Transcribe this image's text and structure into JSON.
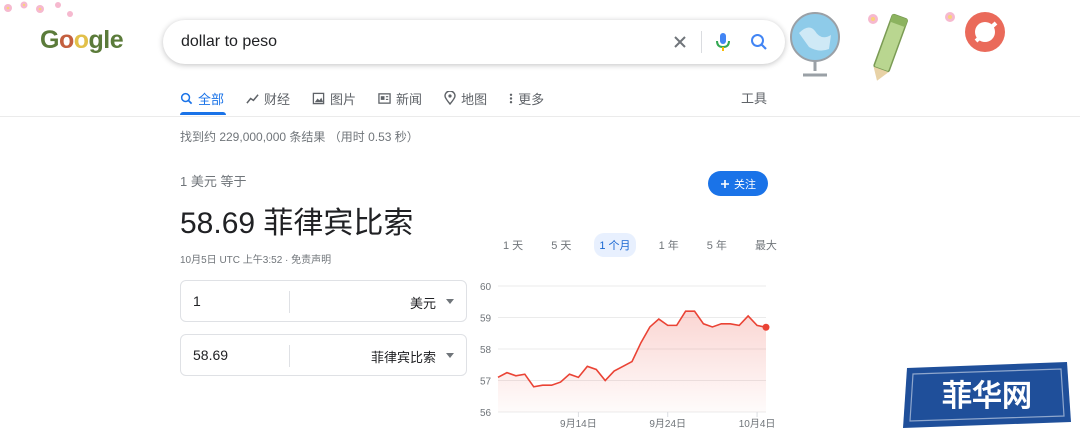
{
  "logo": {
    "text": "Google"
  },
  "search": {
    "query": "dollar to peso"
  },
  "tabs": [
    {
      "label": "全部",
      "icon": "search-icon",
      "active": true
    },
    {
      "label": "财经",
      "icon": "finance-icon"
    },
    {
      "label": "图片",
      "icon": "image-icon"
    },
    {
      "label": "新闻",
      "icon": "news-icon"
    },
    {
      "label": "地图",
      "icon": "map-pin-icon"
    },
    {
      "label": "更多",
      "icon": "more-dots-icon"
    }
  ],
  "tools_label": "工具",
  "stats": "找到约 229,000,000 条结果 （用时 0.53 秒）",
  "converter": {
    "equals_text": "1 美元 等于",
    "result_text": "58.69 菲律宾比索",
    "timestamp": "10月5日 UTC 上午3:52 · 免责声明",
    "follow_label": "关注",
    "from": {
      "value": "1",
      "unit": "美元"
    },
    "to": {
      "value": "58.69",
      "unit": "菲律宾比索"
    }
  },
  "ranges": [
    "1 天",
    "5 天",
    "1 个月",
    "1 年",
    "5 年",
    "最大"
  ],
  "active_range": "1 个月",
  "chart_data": {
    "type": "area",
    "y_ticks": [
      "60",
      "59",
      "58",
      "57",
      "56"
    ],
    "x_ticks": [
      "9月14日",
      "9月24日",
      "10月4日"
    ],
    "ylim": [
      56,
      60
    ],
    "x": [
      "9月5日",
      "9月6日",
      "9月7日",
      "9月8日",
      "9月9日",
      "9月10日",
      "9月11日",
      "9月12日",
      "9月13日",
      "9月14日",
      "9月15日",
      "9月16日",
      "9月17日",
      "9月18日",
      "9月19日",
      "9月20日",
      "9月21日",
      "9月22日",
      "9月23日",
      "9月24日",
      "9月25日",
      "9月26日",
      "9月27日",
      "9月28日",
      "9月29日",
      "9月30日",
      "10月1日",
      "10月2日",
      "10月3日",
      "10月4日",
      "10月5日"
    ],
    "values": [
      57.1,
      57.25,
      57.15,
      57.2,
      56.8,
      56.85,
      56.85,
      56.95,
      57.2,
      57.1,
      57.45,
      57.35,
      57.0,
      57.3,
      57.45,
      57.6,
      58.2,
      58.7,
      58.95,
      58.75,
      58.75,
      59.2,
      59.2,
      58.8,
      58.7,
      58.8,
      58.8,
      58.75,
      59.05,
      58.75,
      58.69
    ],
    "line_color": "#ea4335"
  },
  "watermark": {
    "text": "菲华网"
  }
}
